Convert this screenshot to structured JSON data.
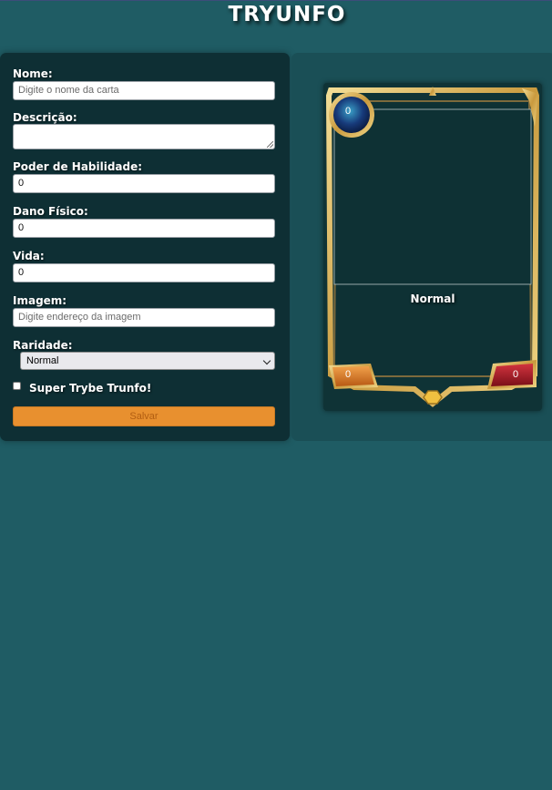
{
  "header": {
    "title": "TRYUNFO"
  },
  "form": {
    "name": {
      "label": "Nome:",
      "placeholder": "Digite o nome da carta",
      "value": ""
    },
    "description": {
      "label": "Descrição:",
      "value": ""
    },
    "ability_power": {
      "label": "Poder de Habilidade:",
      "value": "0"
    },
    "physical_damage": {
      "label": "Dano Físico:",
      "value": "0"
    },
    "life": {
      "label": "Vida:",
      "value": "0"
    },
    "image": {
      "label": "Imagem:",
      "placeholder": "Digite endereço da imagem",
      "value": ""
    },
    "rarity": {
      "label": "Raridade:",
      "selected": "Normal"
    },
    "super_trunfo": {
      "label": "Super Trybe Trunfo!",
      "checked": false
    },
    "save_label": "Salvar"
  },
  "card": {
    "name": "Normal",
    "ability_power": "0",
    "physical_damage": "0",
    "life": "0"
  },
  "colors": {
    "background": "#1f5c64",
    "form_panel": "#0e2f34",
    "save_button": "#e8902f",
    "frame_gold": "#d8b25a"
  }
}
